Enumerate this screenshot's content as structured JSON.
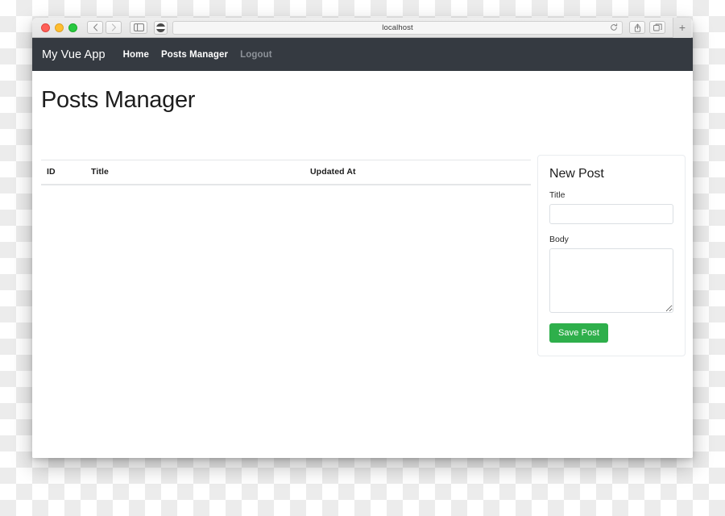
{
  "browser": {
    "traffic_lights": [
      "close",
      "minimize",
      "maximize"
    ],
    "back_icon": "chevron-left-icon",
    "forward_icon": "chevron-right-icon",
    "sidebar_icon": "sidebar-toggle-icon",
    "shield_icon": "content-blocker-icon",
    "url": "localhost",
    "reload_icon": "reload-icon",
    "share_icon": "share-icon",
    "tabs_icon": "show-tabs-icon",
    "new_tab_label": "+"
  },
  "navbar": {
    "brand": "My Vue App",
    "links": [
      {
        "label": "Home",
        "muted": false
      },
      {
        "label": "Posts Manager",
        "muted": false
      },
      {
        "label": "Logout",
        "muted": true
      }
    ]
  },
  "main": {
    "page_title": "Posts Manager",
    "table": {
      "columns": [
        "ID",
        "Title",
        "Updated At"
      ],
      "rows": []
    }
  },
  "new_post": {
    "heading": "New Post",
    "title_label": "Title",
    "title_value": "",
    "title_placeholder": "",
    "body_label": "Body",
    "body_value": "",
    "body_placeholder": "",
    "save_label": "Save Post"
  },
  "colors": {
    "navbar_bg": "#353a41",
    "save_button": "#2eaf4b",
    "muted_link": "#8d9299",
    "card_border": "#e9ecef",
    "input_border": "#dbdfe3"
  }
}
